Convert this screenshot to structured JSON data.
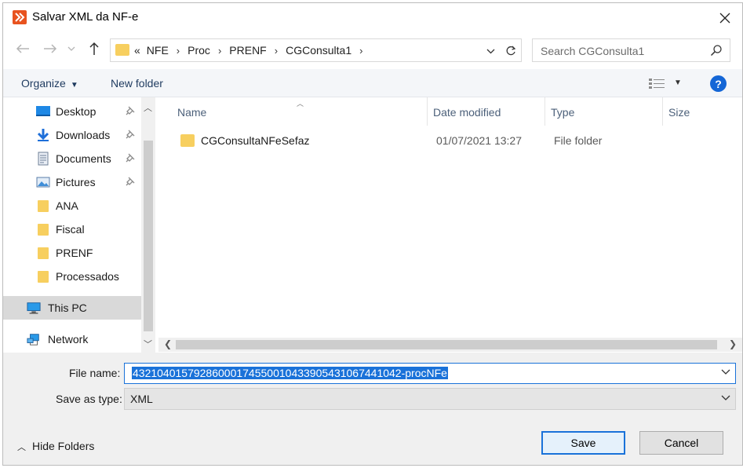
{
  "dialog": {
    "title": "Salvar XML da NF-e"
  },
  "address_bar": {
    "overflow": "«",
    "crumbs": [
      "NFE",
      "Proc",
      "PRENF",
      "CGConsulta1"
    ]
  },
  "search": {
    "placeholder": "Search CGConsulta1"
  },
  "command_bar": {
    "organize_label": "Organize",
    "new_folder_label": "New folder",
    "help_label": "?"
  },
  "nav_pane": {
    "items": [
      {
        "label": "Desktop",
        "icon": "desktop-icon",
        "pinned": true
      },
      {
        "label": "Downloads",
        "icon": "downloads-icon",
        "pinned": true
      },
      {
        "label": "Documents",
        "icon": "documents-icon",
        "pinned": true
      },
      {
        "label": "Pictures",
        "icon": "pictures-icon",
        "pinned": true
      },
      {
        "label": "ANA",
        "icon": "folder-icon",
        "pinned": false
      },
      {
        "label": "Fiscal",
        "icon": "folder-icon",
        "pinned": false
      },
      {
        "label": "PRENF",
        "icon": "folder-icon",
        "pinned": false
      },
      {
        "label": "Processados",
        "icon": "folder-icon",
        "pinned": false
      },
      {
        "label": "This PC",
        "icon": "this-pc-icon",
        "pinned": false,
        "selected": true
      },
      {
        "label": "Network",
        "icon": "network-icon",
        "pinned": false
      }
    ]
  },
  "file_list": {
    "columns": [
      "Name",
      "Date modified",
      "Type",
      "Size"
    ],
    "rows": [
      {
        "name": "CGConsultaNFeSefaz",
        "date_modified": "01/07/2021 13:27",
        "type": "File folder",
        "size": ""
      }
    ]
  },
  "form": {
    "file_name_label": "File name:",
    "file_name_value": "43210401579286000174550010433905431067441042-procNFe",
    "save_as_type_label": "Save as type:",
    "save_as_type_value": "XML"
  },
  "footer": {
    "hide_folders_label": "Hide Folders",
    "save_label": "Save",
    "cancel_label": "Cancel"
  },
  "colors": {
    "accent": "#1a72d9",
    "folder": "#f7cf5f",
    "app_icon": "#e8531f"
  }
}
